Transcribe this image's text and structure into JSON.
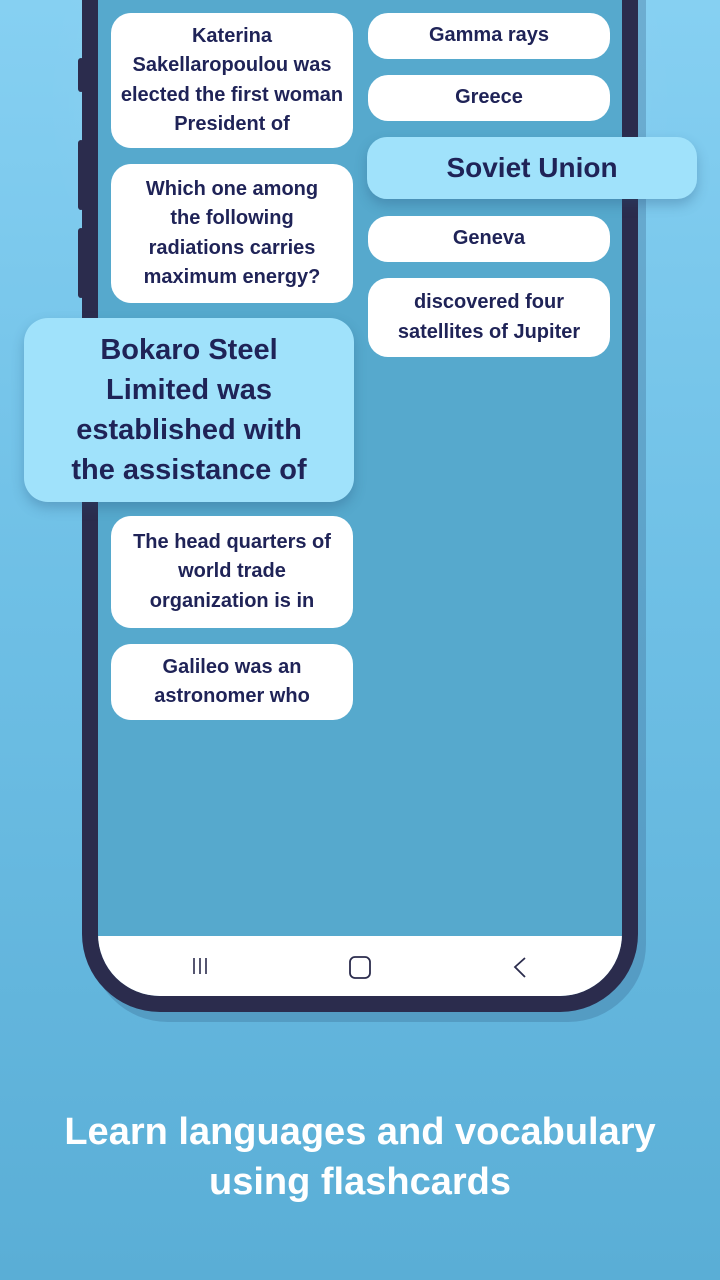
{
  "left_cards": [
    {
      "text": "Katerina Sakellaropoulou was elected the first woman President of",
      "selected": false
    },
    {
      "text": "Which one among the following radiations carries maximum energy?",
      "selected": false
    },
    {
      "text": "Bokaro Steel Limited was established with the assistance of",
      "selected": true
    },
    {
      "text": "The head quarters of world trade organization is in",
      "selected": false
    },
    {
      "text": "Galileo was an astronomer who",
      "selected": false
    }
  ],
  "right_cards": [
    {
      "text": "Gamma rays",
      "selected": false
    },
    {
      "text": "Greece",
      "selected": false
    },
    {
      "text": "Soviet Union",
      "selected": true
    },
    {
      "text": "Geneva",
      "selected": false
    },
    {
      "text": "discovered four satellites of Jupiter",
      "selected": false
    }
  ],
  "nav": {
    "recents_icon": "recent-apps-icon",
    "home_icon": "home-icon",
    "back_icon": "back-icon"
  },
  "caption": {
    "line1": "Learn languages and vocabulary",
    "line2": "using flashcards"
  },
  "colors": {
    "selected_card": "#a0e2fb",
    "card_text": "#1f2357",
    "screen": "#56a9cd",
    "frame": "#2b2c4d"
  }
}
